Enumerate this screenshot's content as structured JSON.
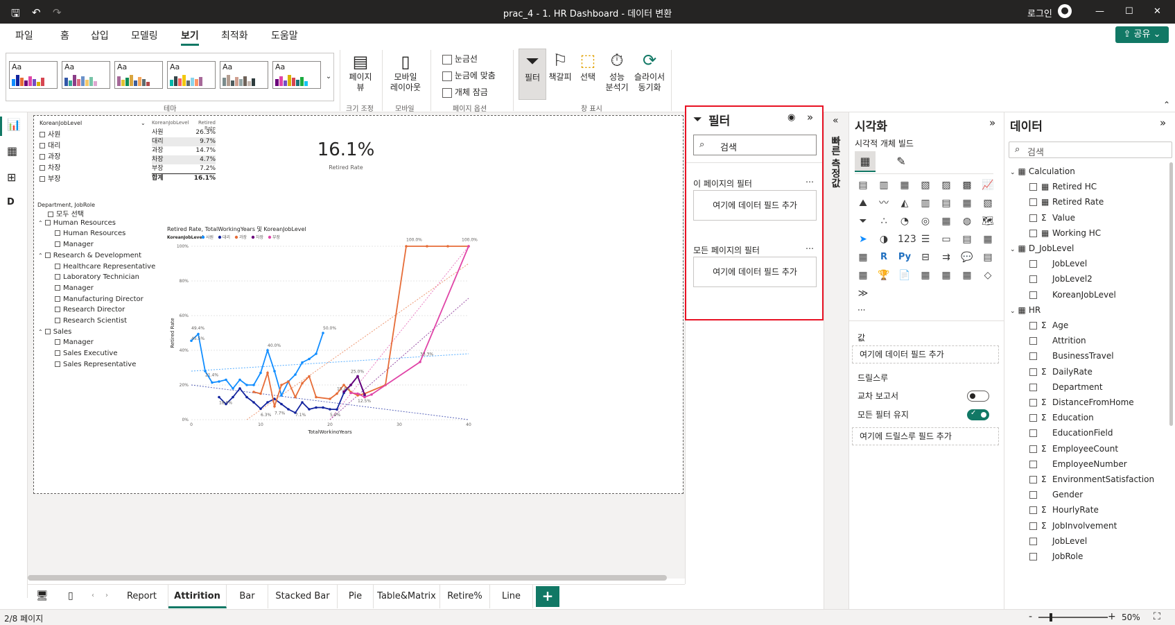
{
  "titlebar": {
    "title": "prac_4 - 1. HR Dashboard - 데이터 변환",
    "signin": "로그인"
  },
  "menu": [
    "파일",
    "홈",
    "삽입",
    "모델링",
    "보기",
    "최적화",
    "도움말"
  ],
  "menu_active": "보기",
  "share_label": "공유",
  "ribbon": {
    "themes_group": "테마",
    "page_view": "페이지\n뷰",
    "page_view_line1": "페이지",
    "page_view_line2": "뷰",
    "size_group": "크기 조정",
    "mobile_layout_line1": "모바일",
    "mobile_layout_line2": "레이아웃",
    "mobile_group": "모바일",
    "gridlines": "눈금선",
    "snap": "눈금에 맞춤",
    "lock": "개체 잠금",
    "page_options_group": "페이지 옵션",
    "filter_btn": "필터",
    "bookmark_btn": "책갈피",
    "selection_btn": "선택",
    "perf_line1": "성능",
    "perf_line2": "분석기",
    "sync_line1": "슬라이서",
    "sync_line2": "동기화",
    "show_group": "창 표시"
  },
  "slicer1": {
    "header": "KoreanJobLevel",
    "items": [
      "사원",
      "대리",
      "과장",
      "차장",
      "부장"
    ]
  },
  "table1": {
    "headers": [
      "KoreanJobLevel",
      "Retired Rate"
    ],
    "rows": [
      [
        "사원",
        "26.3%"
      ],
      [
        "대리",
        "9.7%"
      ],
      [
        "과장",
        "14.7%"
      ],
      [
        "차장",
        "4.7%"
      ],
      [
        "부장",
        "7.2%"
      ]
    ],
    "total": [
      "합계",
      "16.1%"
    ]
  },
  "card": {
    "value": "16.1%",
    "label": "Retired Rate"
  },
  "slicer2": {
    "header": "Department, JobRole",
    "select_all": "모두 선택",
    "groups": [
      {
        "name": "Human Resources",
        "items": [
          "Human Resources",
          "Manager"
        ]
      },
      {
        "name": "Research & Development",
        "items": [
          "Healthcare Representative",
          "Laboratory Technician",
          "Manager",
          "Manufacturing Director",
          "Research Director",
          "Research Scientist"
        ]
      },
      {
        "name": "Sales",
        "items": [
          "Manager",
          "Sales Executive",
          "Sales Representative"
        ]
      }
    ]
  },
  "chart_data": {
    "type": "line",
    "title": "Retired Rate, TotalWorkingYears 및 KoreanJobLevel",
    "legend_title": "KoreanJobLevel",
    "legend_position": "top-left",
    "xlabel": "TotalWorkingYears",
    "ylabel": "Retired Rate",
    "xlim": [
      0,
      40
    ],
    "ylim": [
      0,
      100
    ],
    "x_ticks": [
      "0",
      "10",
      "20",
      "30",
      "40"
    ],
    "y_ticks": [
      "0%",
      "20%",
      "40%",
      "60%",
      "80%",
      "100%"
    ],
    "series": [
      {
        "name": "사원",
        "color": "#118DFF",
        "x": [
          0,
          1,
          2,
          3,
          4,
          5,
          6,
          7,
          8,
          9,
          10,
          11,
          12,
          13,
          14,
          15,
          16,
          17,
          18,
          19
        ],
        "y": [
          45.5,
          49.4,
          28,
          21.4,
          22,
          23,
          18,
          23,
          20,
          20,
          27,
          40,
          28,
          14,
          22,
          26,
          33,
          35,
          38,
          50
        ]
      },
      {
        "name": "대리",
        "color": "#12239E",
        "x": [
          4,
          5,
          6,
          7,
          8,
          9,
          10,
          11,
          12,
          13,
          14,
          15,
          16,
          17,
          18,
          19,
          20,
          21,
          22,
          23,
          24,
          25
        ],
        "y": [
          13,
          9,
          13,
          18,
          13,
          10,
          6.3,
          10,
          12,
          9,
          6,
          4,
          10,
          6,
          7,
          7,
          6,
          5.9,
          15.4,
          20,
          25,
          14
        ]
      },
      {
        "name": "과장",
        "color": "#E66C37",
        "x": [
          9,
          10,
          11,
          12,
          13,
          14,
          15,
          16,
          17,
          18,
          20,
          21,
          22,
          23,
          24,
          25,
          28,
          31,
          34,
          37,
          40
        ],
        "y": [
          16,
          15,
          27,
          7.7,
          20,
          22,
          13,
          21,
          25,
          13,
          12,
          15,
          20,
          16,
          14,
          15,
          20,
          100,
          100,
          100,
          100
        ]
      },
      {
        "name": "차장",
        "color": "#6B007B",
        "x": [
          22,
          23,
          24,
          25
        ],
        "y": [
          16.2,
          20,
          25,
          14.5
        ]
      },
      {
        "name": "부장",
        "color": "#E044A7",
        "x": [
          23,
          24,
          25,
          26,
          33,
          40
        ],
        "y": [
          15.4,
          15,
          13,
          14.5,
          33.3,
          100
        ]
      }
    ],
    "data_labels": [
      "49.4%",
      "45.5%",
      "21.4%",
      "40.0%",
      "50.0%",
      "18.0%",
      "6.3%",
      "7.7%",
      "7.1%",
      "5.9%",
      "25.0%",
      "15.4%",
      "12.5%",
      "100.0%",
      "33.3%",
      "100.0%"
    ]
  },
  "tabs": [
    "Report",
    "Attirition",
    "Bar",
    "Stacked Bar",
    "Pie",
    "Table&Matrix",
    "Retire%",
    "Line"
  ],
  "active_tab": "Attirition",
  "status": {
    "page": "2/8 페이지",
    "zoom": "50%"
  },
  "filters": {
    "title": "필터",
    "search_placeholder": "검색",
    "this_page": "이 페이지의 필터",
    "all_pages": "모든 페이지의 필터",
    "add_field": "여기에 데이터 필드 추가"
  },
  "quick_measure": "빠른 측정값",
  "viz": {
    "title": "시각화",
    "build": "시각적 개체 빌드",
    "values": "값",
    "add_field": "여기에 데이터 필드 추가",
    "drill": "드릴스루",
    "cross_report": "교차 보고서",
    "keep_filters": "모든 필터 유지",
    "add_drill": "여기에 드릴스루 필드 추가"
  },
  "data": {
    "title": "데이터",
    "search_placeholder": "검색",
    "tables": [
      {
        "name": "Calculation",
        "fields": [
          {
            "n": "Retired HC",
            "k": "calc"
          },
          {
            "n": "Retired Rate",
            "k": "calc"
          },
          {
            "n": "Value",
            "k": "sum"
          },
          {
            "n": "Working HC",
            "k": "calc"
          }
        ]
      },
      {
        "name": "D_JobLevel",
        "fields": [
          {
            "n": "JobLevel",
            "k": ""
          },
          {
            "n": "JobLevel2",
            "k": ""
          },
          {
            "n": "KoreanJobLevel",
            "k": ""
          }
        ]
      },
      {
        "name": "HR",
        "fields": [
          {
            "n": "Age",
            "k": "sum"
          },
          {
            "n": "Attrition",
            "k": ""
          },
          {
            "n": "BusinessTravel",
            "k": ""
          },
          {
            "n": "DailyRate",
            "k": "sum"
          },
          {
            "n": "Department",
            "k": ""
          },
          {
            "n": "DistanceFromHome",
            "k": "sum"
          },
          {
            "n": "Education",
            "k": "sum"
          },
          {
            "n": "EducationField",
            "k": ""
          },
          {
            "n": "EmployeeCount",
            "k": "sum"
          },
          {
            "n": "EmployeeNumber",
            "k": ""
          },
          {
            "n": "EnvironmentSatisfaction",
            "k": "sum"
          },
          {
            "n": "Gender",
            "k": ""
          },
          {
            "n": "HourlyRate",
            "k": "sum"
          },
          {
            "n": "JobInvolvement",
            "k": "sum"
          },
          {
            "n": "JobLevel",
            "k": ""
          },
          {
            "n": "JobRole",
            "k": ""
          }
        ]
      }
    ]
  }
}
